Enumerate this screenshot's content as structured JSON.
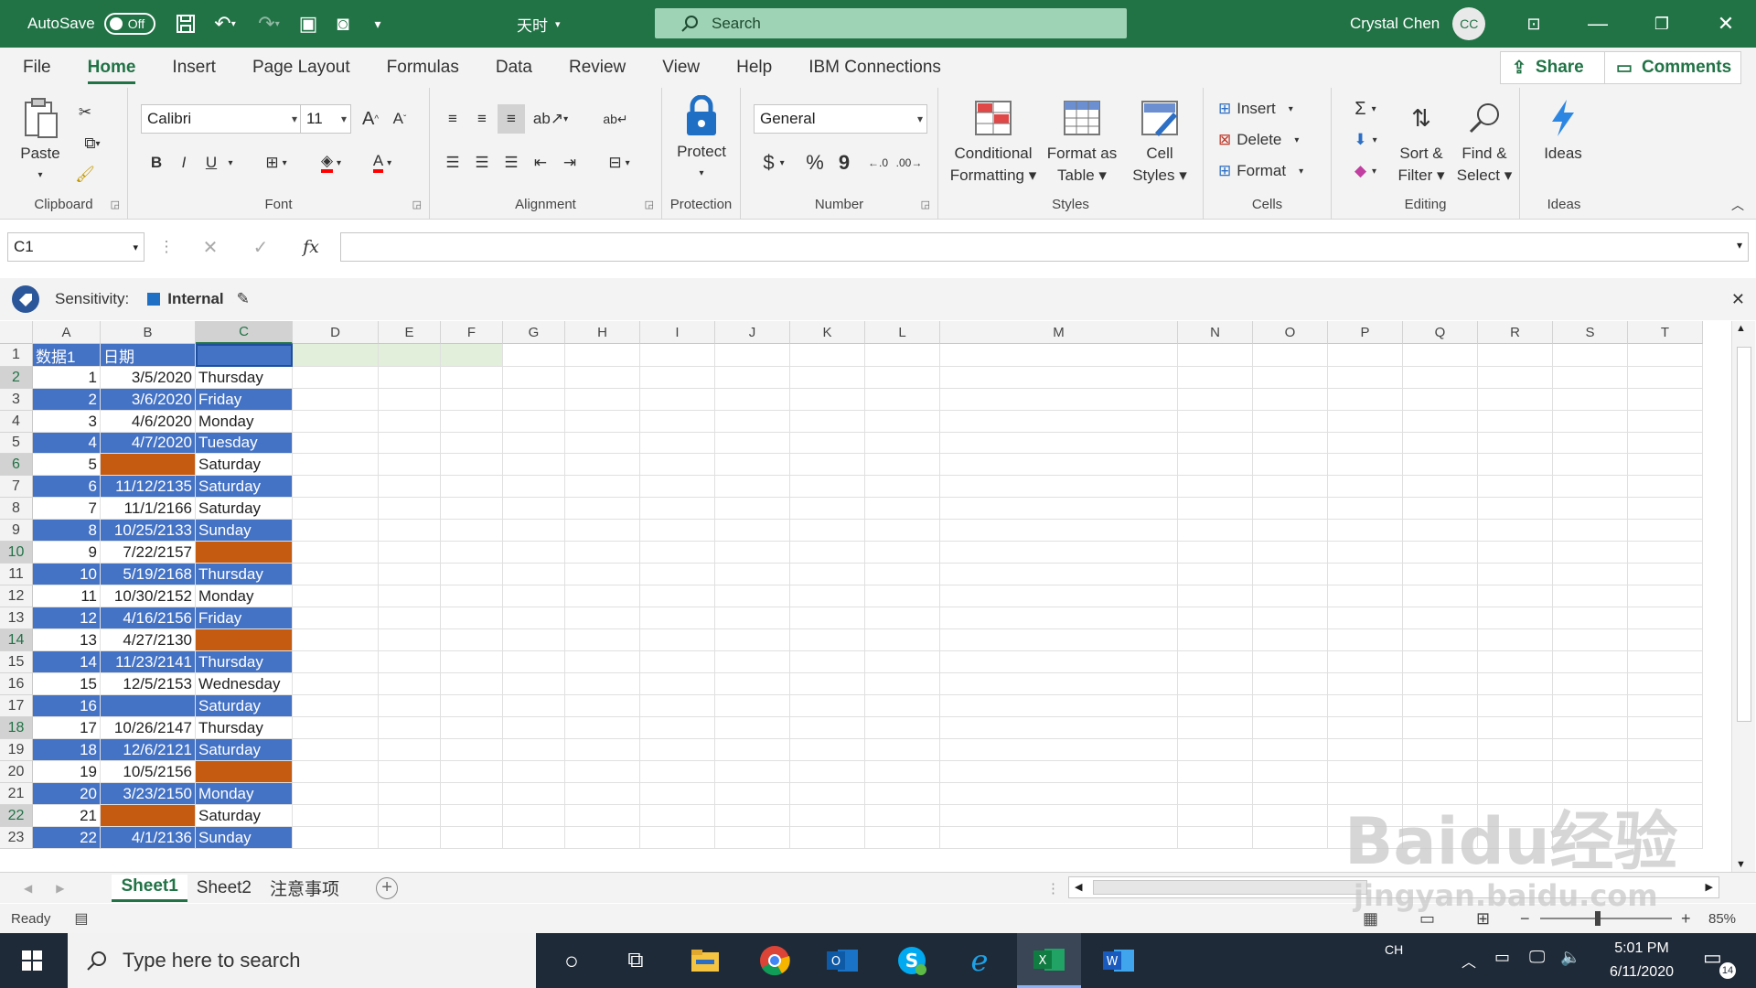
{
  "titlebar": {
    "autosave_label": "AutoSave",
    "autosave_state": "Off",
    "font_name": "天时",
    "search_placeholder": "Search",
    "user_name": "Crystal Chen",
    "user_initials": "CC"
  },
  "menu": {
    "tabs": [
      "File",
      "Home",
      "Insert",
      "Page Layout",
      "Formulas",
      "Data",
      "Review",
      "View",
      "Help",
      "IBM Connections"
    ],
    "active": "Home",
    "share": "Share",
    "comments": "Comments"
  },
  "ribbon": {
    "clipboard": {
      "label": "Clipboard",
      "paste": "Paste"
    },
    "font": {
      "label": "Font",
      "font_name": "Calibri",
      "font_size": "11",
      "bold": "B",
      "italic": "I",
      "underline": "U",
      "font_color_glyph": "A"
    },
    "alignment": {
      "label": "Alignment"
    },
    "protection": {
      "label": "Protection",
      "protect": "Protect"
    },
    "number": {
      "label": "Number",
      "format": "General",
      "currency": "$",
      "percent": "%",
      "comma": "9"
    },
    "styles": {
      "label": "Styles",
      "conditional": [
        "Conditional",
        "Formatting"
      ],
      "format_table": [
        "Format as",
        "Table"
      ],
      "cell_styles": [
        "Cell",
        "Styles"
      ]
    },
    "cells": {
      "label": "Cells",
      "insert": "Insert",
      "delete": "Delete",
      "format": "Format"
    },
    "editing": {
      "label": "Editing",
      "sort": [
        "Sort &",
        "Filter"
      ],
      "find": [
        "Find &",
        "Select"
      ]
    },
    "ideas": {
      "label": "Ideas",
      "ideas": "Ideas"
    }
  },
  "formula_bar": {
    "name_box": "C1",
    "fx": "fx",
    "formula": ""
  },
  "sensitivity": {
    "label": "Sensitivity:",
    "value": "Internal"
  },
  "grid": {
    "columns": [
      "A",
      "B",
      "C",
      "D",
      "E",
      "F",
      "G",
      "H",
      "I",
      "J",
      "K",
      "L",
      "M",
      "N",
      "O",
      "P",
      "Q",
      "R",
      "S",
      "T"
    ],
    "rows": [
      {
        "n": "1",
        "a": "数据1",
        "b": "日期",
        "c": "",
        "style": "header"
      },
      {
        "n": "2",
        "a": "1",
        "b": "3/5/2020",
        "c": "Thursday",
        "style": "white"
      },
      {
        "n": "3",
        "a": "2",
        "b": "3/6/2020",
        "c": "Friday",
        "style": "blue"
      },
      {
        "n": "4",
        "a": "3",
        "b": "4/6/2020",
        "c": "Monday",
        "style": "white"
      },
      {
        "n": "5",
        "a": "4",
        "b": "4/7/2020",
        "c": "Tuesday",
        "style": "blue"
      },
      {
        "n": "6",
        "a": "5",
        "b": "",
        "c": "Saturday",
        "style": "white",
        "b_fill": "orange"
      },
      {
        "n": "7",
        "a": "6",
        "b": "11/12/2135",
        "c": "Saturday",
        "style": "blue"
      },
      {
        "n": "8",
        "a": "7",
        "b": "11/1/2166",
        "c": "Saturday",
        "style": "white"
      },
      {
        "n": "9",
        "a": "8",
        "b": "10/25/2133",
        "c": "Sunday",
        "style": "blue"
      },
      {
        "n": "10",
        "a": "9",
        "b": "7/22/2157",
        "c": "",
        "style": "white",
        "c_fill": "orange"
      },
      {
        "n": "11",
        "a": "10",
        "b": "5/19/2168",
        "c": "Thursday",
        "style": "blue"
      },
      {
        "n": "12",
        "a": "11",
        "b": "10/30/2152",
        "c": "Monday",
        "style": "white"
      },
      {
        "n": "13",
        "a": "12",
        "b": "4/16/2156",
        "c": "Friday",
        "style": "blue"
      },
      {
        "n": "14",
        "a": "13",
        "b": "4/27/2130",
        "c": "",
        "style": "white",
        "c_fill": "orange"
      },
      {
        "n": "15",
        "a": "14",
        "b": "11/23/2141",
        "c": "Thursday",
        "style": "blue"
      },
      {
        "n": "16",
        "a": "15",
        "b": "12/5/2153",
        "c": "Wednesday",
        "style": "white"
      },
      {
        "n": "17",
        "a": "16",
        "b": "",
        "c": "Saturday",
        "style": "blue"
      },
      {
        "n": "18",
        "a": "17",
        "b": "10/26/2147",
        "c": "Thursday",
        "style": "white"
      },
      {
        "n": "19",
        "a": "18",
        "b": "12/6/2121",
        "c": "Saturday",
        "style": "blue"
      },
      {
        "n": "20",
        "a": "19",
        "b": "10/5/2156",
        "c": "",
        "style": "white",
        "c_fill": "orange"
      },
      {
        "n": "21",
        "a": "20",
        "b": "3/23/2150",
        "c": "Monday",
        "style": "blue"
      },
      {
        "n": "22",
        "a": "21",
        "b": "",
        "c": "Saturday",
        "style": "white",
        "b_fill": "orange"
      },
      {
        "n": "23",
        "a": "22",
        "b": "4/1/2136",
        "c": "Sunday",
        "style": "blue"
      }
    ]
  },
  "sheets": {
    "tabs": [
      "Sheet1",
      "Sheet2",
      "注意事项"
    ],
    "active": "Sheet1"
  },
  "status": {
    "ready": "Ready",
    "zoom": "85%"
  },
  "taskbar": {
    "search_placeholder": "Type here to search",
    "ime": "CH",
    "time": "5:01 PM",
    "date": "6/11/2020",
    "notifications": "14"
  },
  "watermark": {
    "line1": "Baidu经验",
    "line2": "jingyan.baidu.com"
  },
  "colors": {
    "excel_green": "#217346",
    "cell_blue": "#4472c4",
    "cell_orange": "#c55a11"
  }
}
